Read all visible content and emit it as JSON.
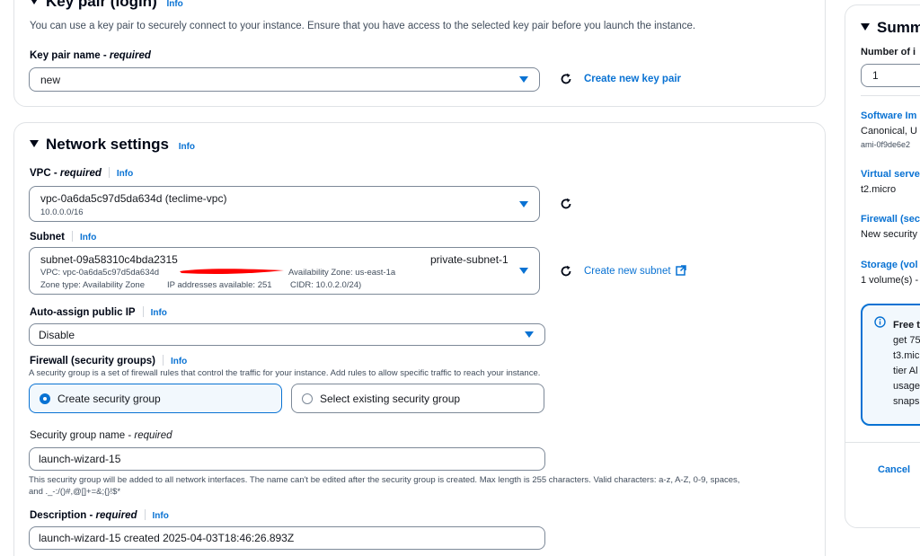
{
  "key_pair": {
    "title": "Key pair (login)",
    "info": "Info",
    "description": "You can use a key pair to securely connect to your instance. Ensure that you have access to the selected key pair before you launch the instance.",
    "name_label": "Key pair name",
    "required": "required",
    "value": "new",
    "create_link": "Create new key pair"
  },
  "network": {
    "title": "Network settings",
    "info": "Info",
    "vpc": {
      "label": "VPC",
      "required": "required",
      "info": "Info",
      "value": "vpc-0a6da5c97d5da634d (teclime-vpc)",
      "cidr": "10.0.0.0/16"
    },
    "subnet": {
      "label": "Subnet",
      "info": "Info",
      "id": "subnet-09a58310c4bda2315",
      "name": "private-subnet-1",
      "vpc_line": "VPC: vpc-0a6da5c97d5da634d",
      "az": "Availability Zone: us-east-1a",
      "zone_type": "Zone type: Availability Zone",
      "ips": "IP addresses available: 251",
      "cidr": "CIDR: 10.0.2.0/24)",
      "create_link": "Create new subnet"
    },
    "public_ip": {
      "label": "Auto-assign public IP",
      "info": "Info",
      "value": "Disable"
    },
    "firewall": {
      "label": "Firewall (security groups)",
      "info": "Info",
      "description": "A security group is a set of firewall rules that control the traffic for your instance. Add rules to allow specific traffic to reach your instance.",
      "option_create": "Create security group",
      "option_select": "Select existing security group"
    },
    "sg_name": {
      "label": "Security group name",
      "required": "required",
      "value": "launch-wizard-15",
      "help1": "This security group will be added to all network interfaces. The name can't be edited after the security group is created. Max length is 255 characters. Valid characters: a-z, A-Z, 0-9, spaces,",
      "help2": "and ._-:/()#,@[]+=&;{}!$*"
    },
    "description_field": {
      "label": "Description",
      "required": "required",
      "info": "Info",
      "value": "launch-wizard-15 created 2025-04-03T18:46:26.893Z"
    }
  },
  "summary": {
    "title": "Summ",
    "instances_label": "Number of i",
    "instances_value": "1",
    "software_label": "Software Im",
    "software_value": "Canonical, U",
    "ami": "ami-0f9de6e2",
    "server_label": "Virtual serve",
    "server_value": "t2.micro",
    "firewall_label": "Firewall (sec",
    "firewall_value": "New security",
    "storage_label": "Storage (vol",
    "storage_value": "1 volume(s) -",
    "free_tier_lines": [
      "Free t",
      "get 75",
      "t3.mic",
      "tier Al",
      "usage",
      "snaps"
    ],
    "cancel": "Cancel"
  },
  "colors": {
    "accent": "#0972d3",
    "selected_bg": "#f2f8fd",
    "redaction": "#ff0000"
  }
}
